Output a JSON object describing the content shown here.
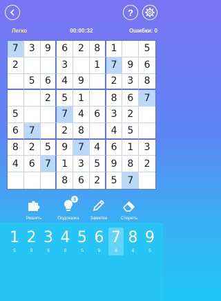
{
  "topbar": {
    "back_icon": "chevron-left-icon",
    "help_label": "?",
    "settings_icon": "gear-icon"
  },
  "status": {
    "difficulty": "Легко",
    "timer": "00:00:32",
    "errors": "Ошибки: 0"
  },
  "board": {
    "rows": [
      [
        "7",
        "3",
        "9",
        "6",
        "2",
        "8",
        "1",
        "",
        "5"
      ],
      [
        "2",
        "",
        "",
        "3",
        "",
        "1",
        "7",
        "9",
        "6"
      ],
      [
        "",
        "5",
        "6",
        "4",
        "9",
        "",
        "2",
        "3",
        "8"
      ],
      [
        "",
        "",
        "2",
        "5",
        "1",
        "",
        "8",
        "6",
        "7"
      ],
      [
        "5",
        "",
        "",
        "7",
        "4",
        "6",
        "3",
        "2",
        ""
      ],
      [
        "6",
        "7",
        "",
        "2",
        "8",
        "",
        "4",
        "5",
        ""
      ],
      [
        "8",
        "2",
        "5",
        "9",
        "7",
        "4",
        "6",
        "1",
        "3"
      ],
      [
        "4",
        "6",
        "7",
        "1",
        "3",
        "5",
        "9",
        "8",
        "2"
      ],
      [
        "",
        "",
        "",
        "8",
        "6",
        "2",
        "5",
        "7",
        ""
      ]
    ],
    "highlighted": [
      [
        0,
        0
      ],
      [
        1,
        6
      ],
      [
        3,
        8
      ],
      [
        4,
        3
      ],
      [
        5,
        1
      ],
      [
        6,
        4
      ],
      [
        7,
        2
      ],
      [
        8,
        7
      ]
    ]
  },
  "tools": [
    {
      "label": "Решить",
      "icon": "puzzle-icon"
    },
    {
      "label": "Подсказка",
      "icon": "lightbulb-icon",
      "badge": "3"
    },
    {
      "label": "Заметки",
      "icon": "pencil-icon"
    },
    {
      "label": "Стереть",
      "icon": "eraser-icon"
    }
  ],
  "numpad": [
    {
      "digit": "1",
      "count": "5"
    },
    {
      "digit": "2",
      "count": "9"
    },
    {
      "digit": "3",
      "count": "6"
    },
    {
      "digit": "4",
      "count": "8"
    },
    {
      "digit": "5",
      "count": "5"
    },
    {
      "digit": "6",
      "count": "9"
    },
    {
      "digit": "7",
      "count": "8"
    },
    {
      "digit": "8",
      "count": "6"
    },
    {
      "digit": "9",
      "count": "5"
    }
  ],
  "numpad_selected": "7",
  "colors": {
    "highlight": "#bcd8f9",
    "accent": "#ffe98a",
    "numpad_bg": "#27c5f5"
  }
}
